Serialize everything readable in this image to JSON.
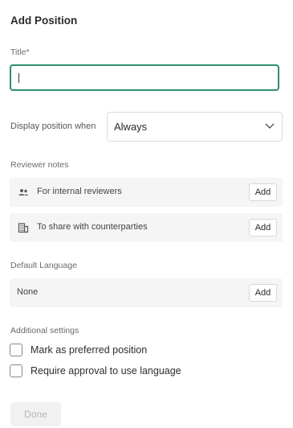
{
  "header": {
    "title": "Add Position"
  },
  "title_field": {
    "label": "Title*",
    "value": ""
  },
  "display_condition": {
    "label": "Display position when",
    "selected": "Always"
  },
  "reviewer_notes": {
    "label": "Reviewer notes",
    "items": [
      {
        "icon": "people-icon",
        "text": "For internal reviewers",
        "button": "Add"
      },
      {
        "icon": "building-icon",
        "text": "To share with counterparties",
        "button": "Add"
      }
    ]
  },
  "default_language": {
    "label": "Default Language",
    "value": "None",
    "button": "Add"
  },
  "additional_settings": {
    "label": "Additional settings",
    "options": [
      {
        "label": "Mark as preferred position",
        "checked": false
      },
      {
        "label": "Require approval to use language",
        "checked": false
      }
    ]
  },
  "footer": {
    "done_label": "Done",
    "done_disabled": true
  },
  "colors": {
    "focus_border": "#2f8f6e",
    "row_background": "#f5f5f5",
    "disabled_text": "#b5b5b5"
  }
}
